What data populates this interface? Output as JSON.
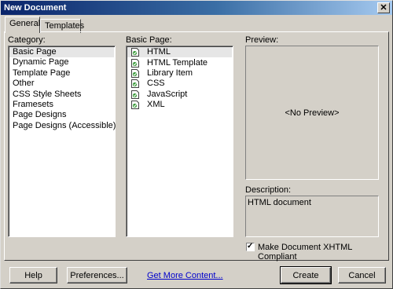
{
  "window": {
    "title": "New Document",
    "close_label": "✕"
  },
  "tabs": [
    {
      "label": "General",
      "active": true
    },
    {
      "label": "Templates",
      "active": false
    }
  ],
  "category": {
    "label": "Category:",
    "items": [
      "Basic Page",
      "Dynamic Page",
      "Template Page",
      "Other",
      "CSS Style Sheets",
      "Framesets",
      "Page Designs",
      "Page Designs (Accessible)"
    ],
    "selected_index": 0
  },
  "basic_page": {
    "label": "Basic Page:",
    "items": [
      "HTML",
      "HTML Template",
      "Library Item",
      "CSS",
      "JavaScript",
      "XML"
    ],
    "selected_index": 0,
    "item_icon": "document-icon"
  },
  "preview": {
    "label": "Preview:",
    "text": "<No Preview>"
  },
  "description": {
    "label": "Description:",
    "text": "HTML document"
  },
  "xhtml": {
    "label": "Make Document XHTML Compliant",
    "checked": true,
    "check_mark": "✓"
  },
  "buttons": {
    "help": "Help",
    "preferences": "Preferences...",
    "create": "Create",
    "cancel": "Cancel"
  },
  "link": {
    "text": "Get More Content..."
  },
  "colors": {
    "title_start": "#0a246a",
    "title_end": "#a6caf0",
    "face": "#d4d0c8",
    "link": "#0000cc"
  }
}
